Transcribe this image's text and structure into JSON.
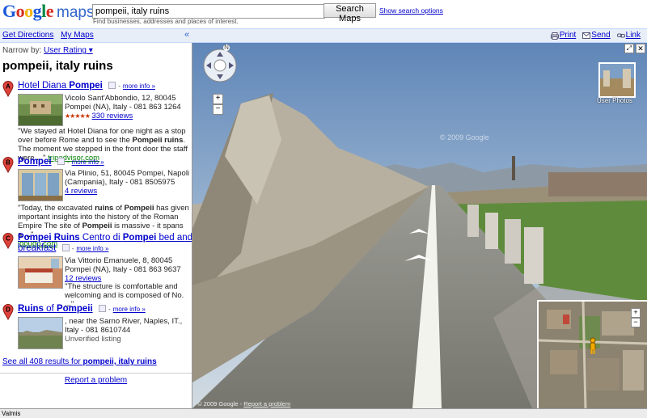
{
  "logo": {
    "google": "Google",
    "maps": "maps"
  },
  "search": {
    "value": "pompeii, italy ruins",
    "hint": "Find businesses, addresses and places of interest.",
    "button": "Search Maps",
    "options": "Show search options"
  },
  "toolbar": {
    "directions": "Get Directions",
    "my_maps": "My Maps",
    "collapse": "«",
    "print": "Print",
    "send": "Send",
    "link": "Link"
  },
  "panel": {
    "narrow_prefix": "Narrow by:",
    "narrow_value": "User Rating ▾",
    "query": "pompeii, italy ruins",
    "results": [
      {
        "letter": "A",
        "title_pre": "Hotel Diana ",
        "title_bold": "Pompei",
        "title_post": "",
        "title_line2": "",
        "more": "more info »",
        "address": "Vicolo Sant'Abbondio, 12, 80045 Pompei (NA), Italy - 081 863 1264",
        "rating": "★★★★★",
        "reviews": "330 reviews",
        "snippet_parts": [
          "\"We stayed at Hotel Diana for one night as a stop over before Rome and to see the ",
          "Pompeii ruins",
          ". The moment we stepped in the front door the staff were ",
          "...",
          "\" "
        ],
        "site": "tripadvisor.com"
      },
      {
        "letter": "B",
        "title_pre": "",
        "title_bold": "Pompei",
        "title_post": "",
        "title_line2": "",
        "more": "more info »",
        "address": "Via Plinio, 51, 80045 Pompei, Napoli (Campania), Italy - 081 8505975",
        "rating": "",
        "reviews": "4 reviews",
        "snippet_parts": [
          "\"Today, the excavated ",
          "ruins",
          " of ",
          "Pompeii",
          " has given important insights into the history of the Roman Empire The site of ",
          "Pompeii",
          " is massive - it spans a ",
          "...",
          "\""
        ],
        "site": "igougo.com"
      },
      {
        "letter": "C",
        "title_pre": "",
        "title_bold": "Pompei Ruins",
        "title_post": " Centro di ",
        "title_bold2": "Pompei",
        "title_post2": " bed and",
        "title_line2": "breakfast",
        "more": "more info »",
        "address": "Via Vittorio Emanuele, 8, 80045 Pompei (NA), Italy - 081 863 9637",
        "rating": "",
        "reviews": "12 reviews",
        "snippet_parts": [
          "\"The structure is comfortable and welcoming and is composed of No. ",
          "...",
          "\""
        ],
        "site": ""
      },
      {
        "letter": "D",
        "title_pre": "",
        "title_bold": "Ruins",
        "title_post": " of ",
        "title_bold2": "Pompeii",
        "title_post2": "",
        "title_line2": "",
        "more": "more info »",
        "address": ", near the Sarno River, Naples, IT., Italy - 081 8610744",
        "rating": "",
        "reviews": "",
        "unverified": "Unverified listing",
        "snippet_parts": [],
        "site": ""
      }
    ],
    "see_all_prefix": "See all 408 results for ",
    "see_all_bold": "pompeii, italy ruins",
    "report": "Report a problem"
  },
  "map": {
    "watermark": "© 2009 Google",
    "copyright": "© 2009 Google",
    "report": "Report a problem",
    "user_photos": "User Photos"
  },
  "status": {
    "text": "Valmis"
  },
  "colors": {
    "marker": "#e0433b",
    "link": "#0000cc",
    "toolbar_bg": "#e8eef7"
  }
}
